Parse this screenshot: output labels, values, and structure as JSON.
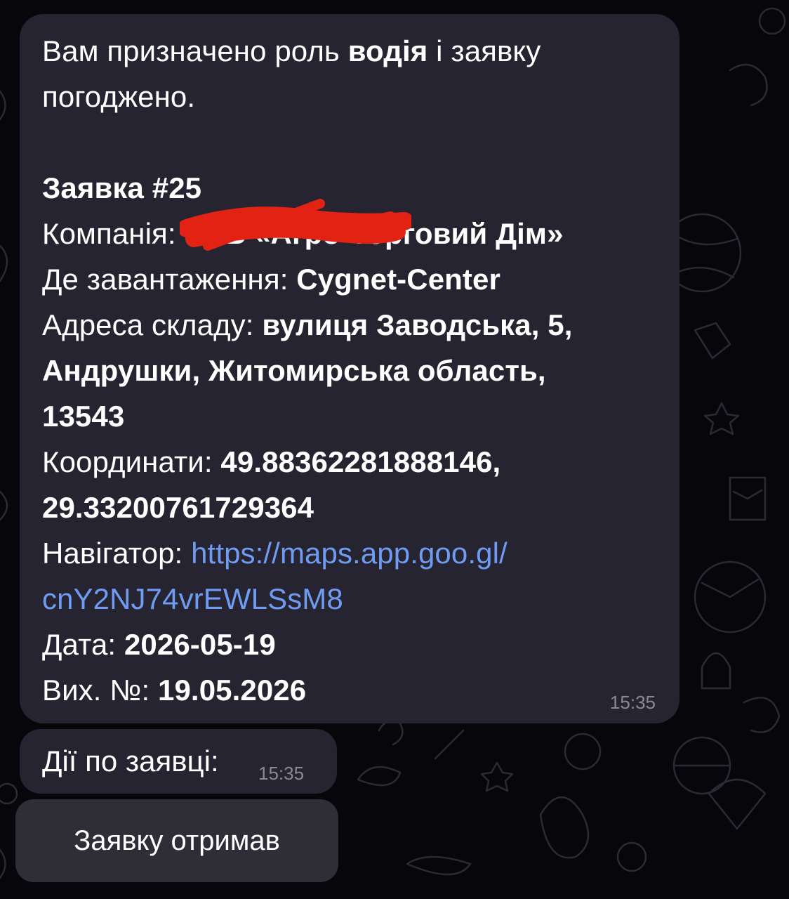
{
  "message": {
    "intro_1": "Вам призначено роль ",
    "intro_role": "водія",
    "intro_2": " і заявку",
    "intro_3": "погоджено.",
    "request_title": "Заявка #25",
    "company_label": "Компанія: ",
    "company_value": "ТОВ «Агро-Торговий Дім»",
    "loading_label": "Де завантаження: ",
    "loading_value": "Cygnet-Center",
    "address_label": "Адреса складу: ",
    "address_value_1": "вулиця Заводська, 5,",
    "address_value_2": "Андрушки, Житомирська область,",
    "address_value_3": "13543",
    "coords_label": "Координати: ",
    "coords_value_1": "49.88362281888146,",
    "coords_value_2": "29.33200761729364",
    "nav_label": "Навігатор: ",
    "nav_link_1": "https://maps.app.goo.gl/",
    "nav_link_2": "cnY2NJ74vrEWLSsM8",
    "date_label": "Дата: ",
    "date_value": "2026-05-19",
    "out_label": "Вих. №: ",
    "out_value": "19.05.2026",
    "time": "15:35"
  },
  "actions_message": {
    "text": "Дії по заявці:",
    "time": "15:35"
  },
  "action_button": {
    "label": "Заявку отримав"
  },
  "colors": {
    "background": "#07070b",
    "bubble": "#262430",
    "link": "#6f9cf2",
    "redaction": "#e22314"
  }
}
